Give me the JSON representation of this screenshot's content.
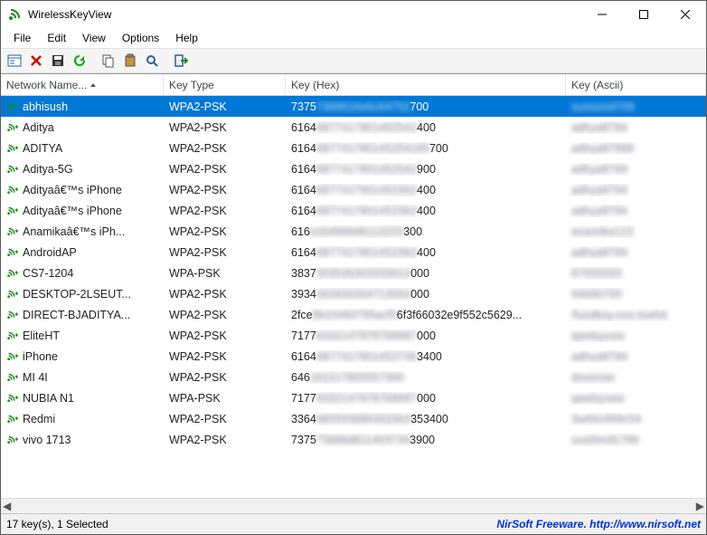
{
  "window": {
    "title": "WirelessKeyView"
  },
  "menus": {
    "file": "File",
    "edit": "Edit",
    "view": "View",
    "options": "Options",
    "help": "Help"
  },
  "columns": {
    "name": "Network Name...",
    "type": "Key Type",
    "hex": "Key (Hex)",
    "ascii": "Key (Ascii)"
  },
  "rows": [
    {
      "name": "abhisush",
      "type": "WPA2-PSK",
      "hex_vis": "7375",
      "hex_blur": "7369616e6c64752",
      "hex_suf": "700",
      "ascii_blur": "susissnd709",
      "selected": true
    },
    {
      "name": "Aditya",
      "type": "WPA2-PSK",
      "hex_vis": "6164",
      "hex_blur": "6877417901452542",
      "hex_suf": "400",
      "ascii_blur": "adhya8794"
    },
    {
      "name": "ADITYA",
      "type": "WPA2-PSK",
      "hex_vis": "6164",
      "hex_blur": "687741790145254195",
      "hex_suf": "700",
      "ascii_blur": "adhya87999"
    },
    {
      "name": "Aditya-5G",
      "type": "WPA2-PSK",
      "hex_vis": "6164",
      "hex_blur": "6877417901452542",
      "hex_suf": "900",
      "ascii_blur": "adhya8799"
    },
    {
      "name": "Adityaâ€™s iPhone",
      "type": "WPA2-PSK",
      "hex_vis": "6164",
      "hex_blur": "6877417901452362",
      "hex_suf": "400",
      "ascii_blur": "adhya8794"
    },
    {
      "name": "Adityaâ€™s iPhone",
      "type": "WPA2-PSK",
      "hex_vis": "6164",
      "hex_blur": "6877417901452362",
      "hex_suf": "400",
      "ascii_blur": "adhya8794"
    },
    {
      "name": "Anamikaâ€™s iPh...",
      "type": "WPA2-PSK",
      "hex_vis": "616",
      "hex_blur": "e1b4996d6113223",
      "hex_suf": "300",
      "ascii_blur": "anamika123"
    },
    {
      "name": "AndroidAP",
      "type": "WPA2-PSK",
      "hex_vis": "6164",
      "hex_blur": "6877417901452362",
      "hex_suf": "400",
      "ascii_blur": "adhya8794"
    },
    {
      "name": "CS7-1204",
      "type": "WPA-PSK",
      "hex_vis": "3837",
      "hex_blur": "303536303333613",
      "hex_suf": "000",
      "ascii_blur": "87050033"
    },
    {
      "name": "DESKTOP-2LSEUT...",
      "type": "WPA2-PSK",
      "hex_vis": "3934",
      "hex_blur": "363930354713093",
      "hex_suf": "000",
      "ascii_blur": "94690700"
    },
    {
      "name": "DIRECT-BJADITYA...",
      "type": "WPA2-PSK",
      "hex_vis": "2fce",
      "hex_blur": "8b10460795acf5",
      "hex_suf": "6f3f66032e9f552c5629...",
      "ascii_blur": "/fusdbsy.oos.tswhd"
    },
    {
      "name": "EliteHT",
      "type": "WPA2-PSK",
      "hex_vis": "7177",
      "hex_blur": "6332147878768997",
      "hex_suf": "000",
      "ascii_blur": "qwebyusio"
    },
    {
      "name": "iPhone",
      "type": "WPA2-PSK",
      "hex_vis": "6164",
      "hex_blur": "6877417901452736",
      "hex_suf": "3400",
      "ascii_blur": "adhya8794"
    },
    {
      "name": "MI 4I",
      "type": "WPA2-PSK",
      "hex_vis": "646",
      "hex_blur": "161517805057300",
      "hex_suf": "",
      "ascii_blur": "doverser"
    },
    {
      "name": "NUBIA N1",
      "type": "WPA-PSK",
      "hex_vis": "7177",
      "hex_blur": "6332147878768997",
      "hex_suf": "000",
      "ascii_blur": "qwebyusio"
    },
    {
      "name": "Redmi",
      "type": "WPA2-PSK",
      "hex_vis": "3364",
      "hex_blur": "680593689363363",
      "hex_suf": "353400",
      "ascii_blur": "3w60c999c54"
    },
    {
      "name": "vivo 1713",
      "type": "WPA2-PSK",
      "hex_vis": "7375",
      "hex_blur": "73686d811403734",
      "hex_suf": "3900",
      "ascii_blur": "susihmd1799"
    }
  ],
  "status": {
    "left": "17 key(s), 1 Selected",
    "right": "NirSoft Freeware. http://www.nirsoft.net"
  }
}
